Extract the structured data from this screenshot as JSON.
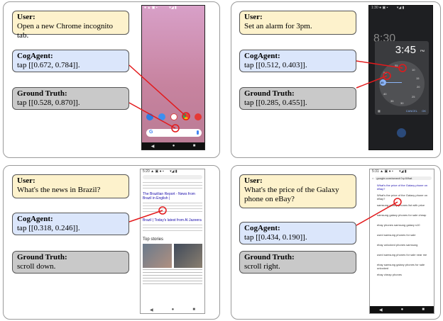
{
  "examples": [
    {
      "user_label": "User:",
      "user_text": "Open a new Chrome incognito tab.",
      "agent_label": "CogAgent:",
      "agent_text": "tap [[0.672, 0.784]].",
      "gt_label": "Ground Truth:",
      "gt_text": "tap [[0.528, 0.870]]."
    },
    {
      "user_label": "User:",
      "user_text": "Set an alarm for 3pm.",
      "agent_label": "CogAgent:",
      "agent_text": "tap [[0.512, 0.403]].",
      "gt_label": "Ground Truth:",
      "gt_text": "tap [[0.285, 0.455]].",
      "clock_time": "3:45",
      "clock_ampm": "PM",
      "clock_bg_time": "8:30",
      "clock_numbers": [
        "55",
        "10",
        "50",
        "15",
        "45",
        "20",
        "40",
        "25",
        "35",
        "30"
      ],
      "cancel": "CANCEL",
      "ok": "OK"
    },
    {
      "user_label": "User:",
      "user_text": "What's the news in Brazil?",
      "agent_label": "CogAgent:",
      "agent_text": "tap [[0.318, 0.246]].",
      "gt_label": "Ground Truth:",
      "gt_text": "scroll down.",
      "news_headline": "The Brazilian Report - News from Brazil in English |",
      "news_headline2": "Brazil | Today's latest from Al Jazeera",
      "top_stories": "Top stories"
    },
    {
      "user_label": "User:",
      "user_text": "What's the price of the Galaxy phone on eBay?",
      "agent_label": "CogAgent:",
      "agent_text": "tap [[0.434, 0.190]].",
      "gt_label": "Ground Truth:",
      "gt_text": "scroll right.",
      "url": "google.com/search?q=What",
      "suggestions": [
        "What's the price of the Galaxy phone on eBay?",
        "samsung galaxy phones list with price",
        "samsung galaxy phones for sale cheap",
        "ebay phones samsung galaxy s10",
        "used samsung phones for sale",
        "ebay unlocked phones samsung",
        "used samsung phones for sale near me",
        "ebay samsung galaxy phones for sale unlocked",
        "ebay cheap phones"
      ]
    }
  ]
}
